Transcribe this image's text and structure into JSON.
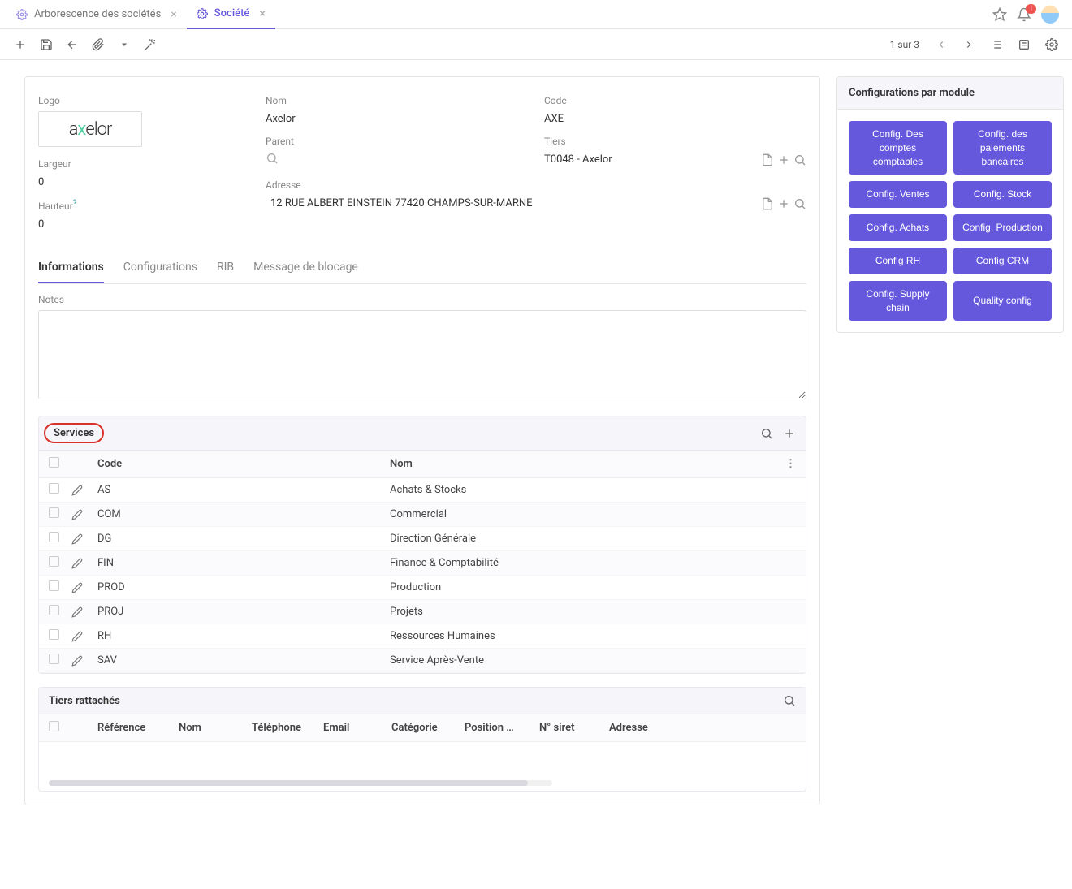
{
  "tabs": [
    {
      "label": "Arborescence des sociétés",
      "active": false
    },
    {
      "label": "Société",
      "active": true
    }
  ],
  "notifications_count": "1",
  "pager": "1 sur 3",
  "form": {
    "logo_label": "Logo",
    "logo_name": "axelor",
    "largeur_label": "Largeur",
    "largeur_value": "0",
    "hauteur_label": "Hauteur",
    "hauteur_value": "0",
    "nom_label": "Nom",
    "nom_value": "Axelor",
    "parent_label": "Parent",
    "parent_value": "",
    "adresse_label": "Adresse",
    "adresse_value": "12 RUE ALBERT EINSTEIN 77420 CHAMPS-SUR-MARNE",
    "code_label": "Code",
    "code_value": "AXE",
    "tiers_label": "Tiers",
    "tiers_value": "T0048 - Axelor"
  },
  "side_panel": {
    "title": "Configurations par module",
    "buttons": [
      "Config. Des comptes comptables",
      "Config. des paiements bancaires",
      "Config. Ventes",
      "Config. Stock",
      "Config. Achats",
      "Config. Production",
      "Config RH",
      "Config CRM",
      "Config. Supply chain",
      "Quality config"
    ]
  },
  "inner_tabs": [
    "Informations",
    "Configurations",
    "RIB",
    "Message de blocage"
  ],
  "notes_label": "Notes",
  "services": {
    "title": "Services",
    "cols": {
      "code": "Code",
      "nom": "Nom"
    },
    "rows": [
      {
        "code": "AS",
        "nom": "Achats & Stocks"
      },
      {
        "code": "COM",
        "nom": "Commercial"
      },
      {
        "code": "DG",
        "nom": "Direction Générale"
      },
      {
        "code": "FIN",
        "nom": "Finance & Comptabilité"
      },
      {
        "code": "PROD",
        "nom": "Production"
      },
      {
        "code": "PROJ",
        "nom": "Projets"
      },
      {
        "code": "RH",
        "nom": "Ressources Humaines"
      },
      {
        "code": "SAV",
        "nom": "Service Après-Vente"
      }
    ]
  },
  "tiers_section": {
    "title": "Tiers rattachés",
    "cols": [
      "Référence",
      "Nom",
      "Téléphone",
      "Email",
      "Catégorie",
      "Position …",
      "N° siret",
      "Adresse"
    ]
  }
}
